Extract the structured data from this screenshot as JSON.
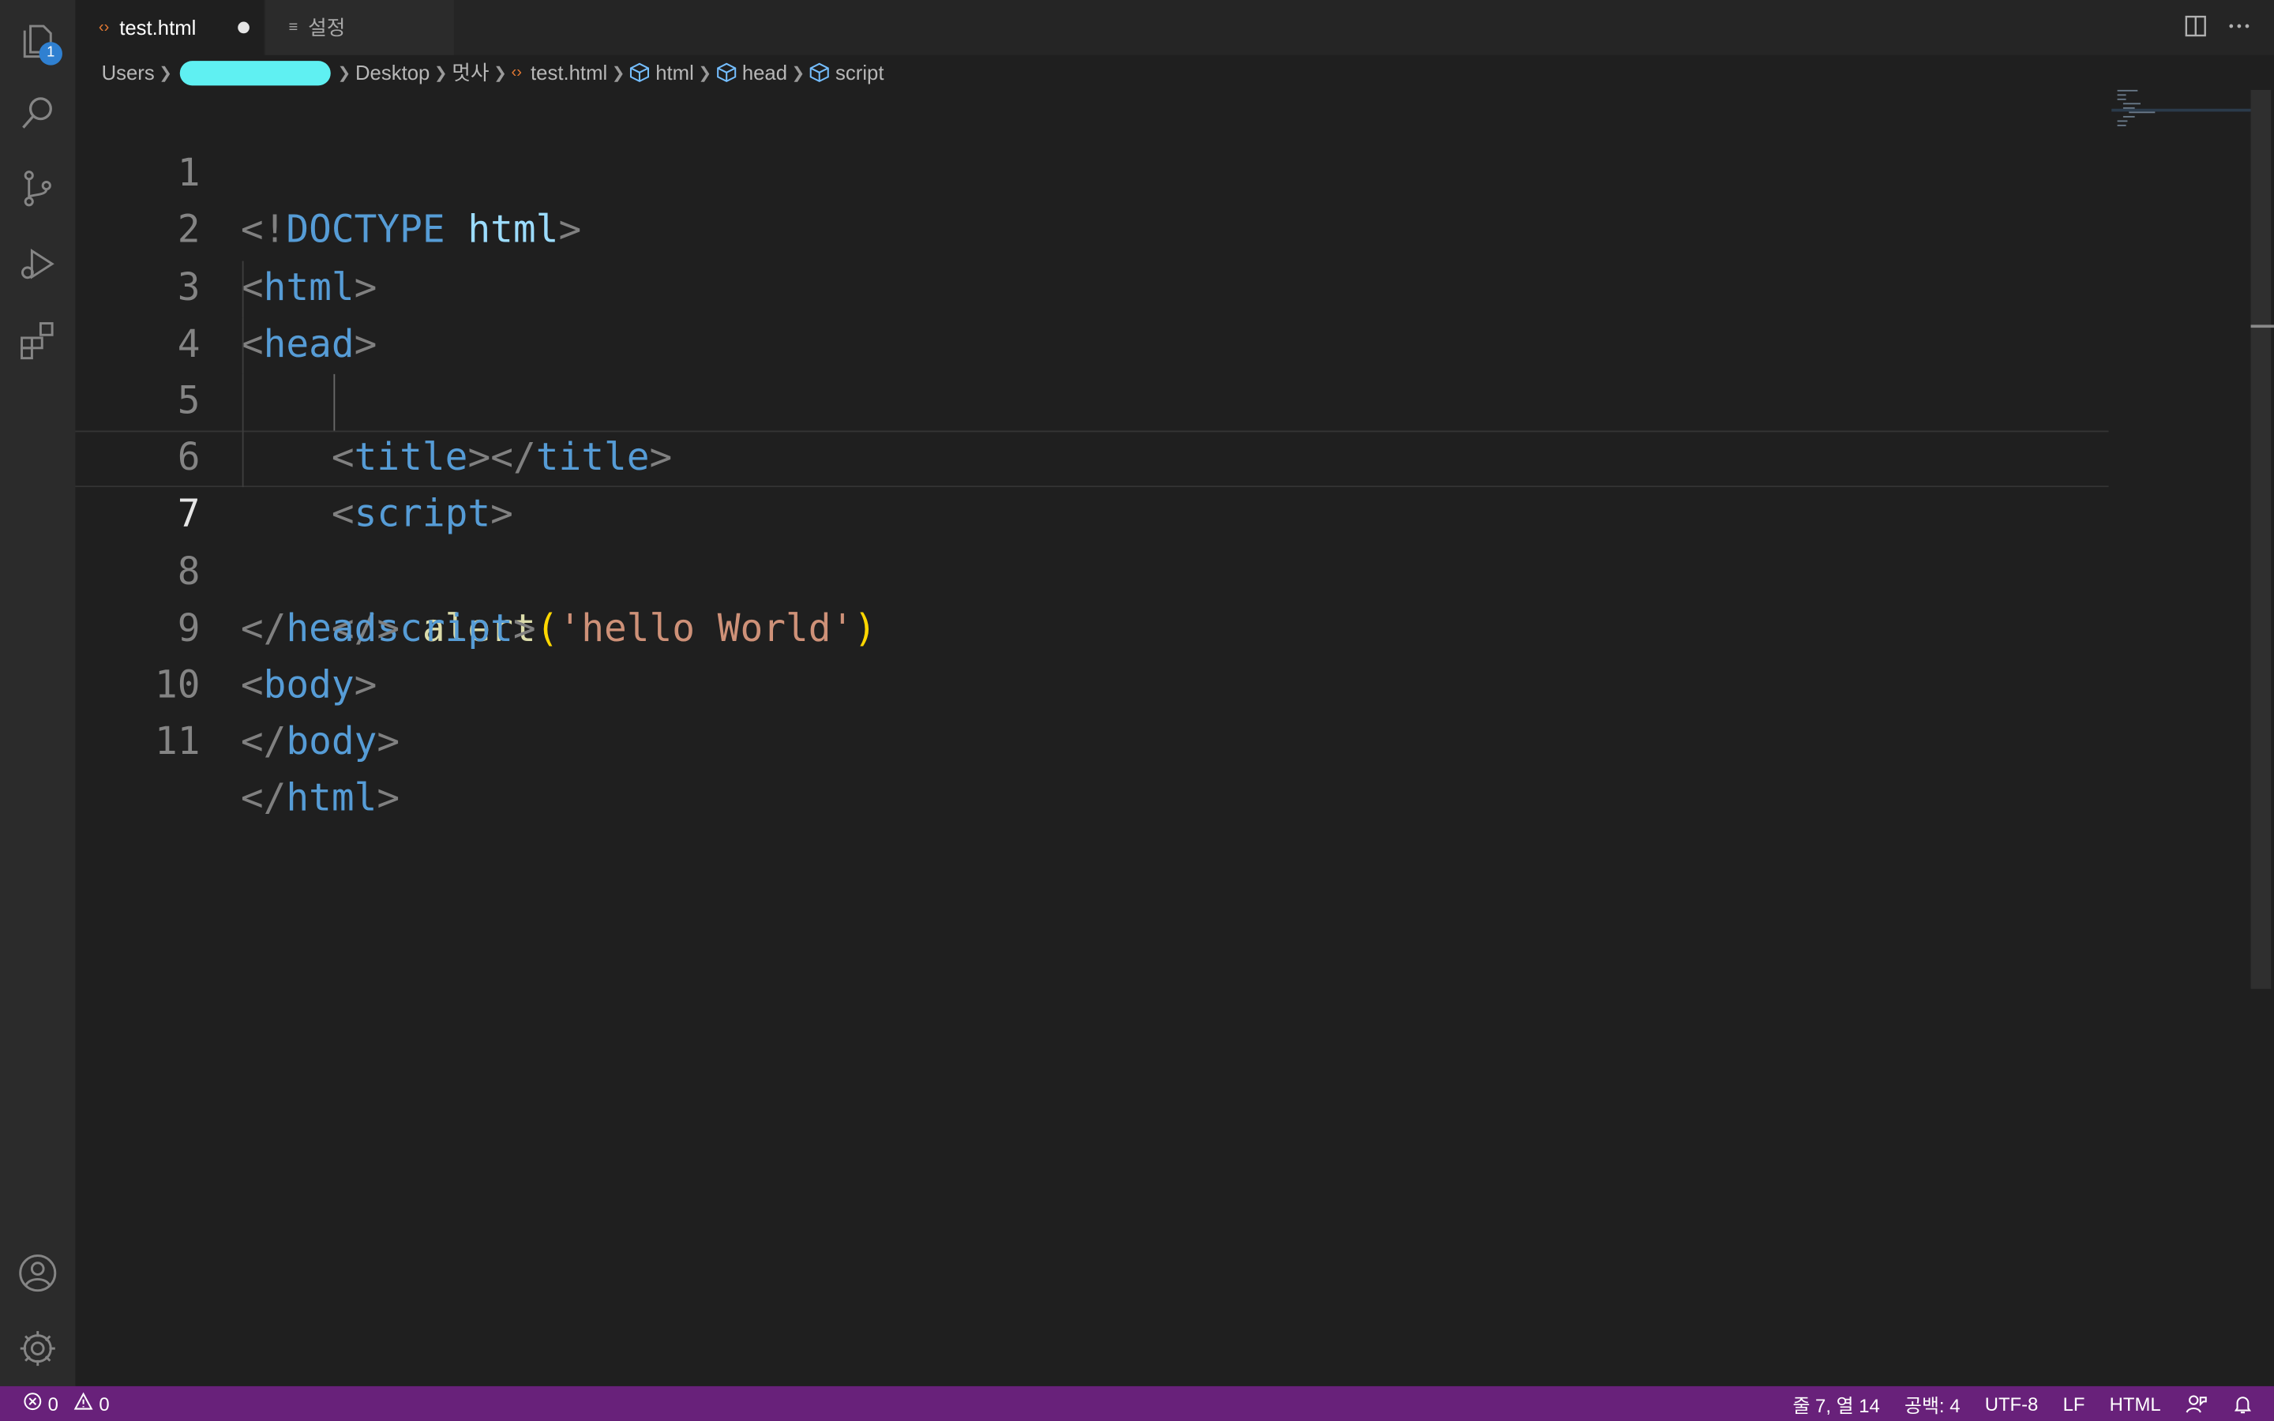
{
  "tabs": [
    {
      "icon": "‹›",
      "label": "test.html",
      "dirty": true
    },
    {
      "icon": "≡",
      "label": "설정"
    }
  ],
  "activity": {
    "explorer_badge": "1"
  },
  "breadcrumb": {
    "items": [
      "Users",
      "Desktop",
      "멋사",
      "test.html",
      "html",
      "head",
      "script"
    ]
  },
  "editor": {
    "lines": [
      {
        "n": "1"
      },
      {
        "n": "2"
      },
      {
        "n": "3"
      },
      {
        "n": "4"
      },
      {
        "n": "5"
      },
      {
        "n": "6"
      },
      {
        "n": "7"
      },
      {
        "n": "8"
      },
      {
        "n": "9"
      },
      {
        "n": "10"
      },
      {
        "n": "11"
      }
    ],
    "tokens": {
      "doctype_kw": "DOCTYPE",
      "doctype_attr": "html",
      "html": "html",
      "head": "head",
      "title": "title",
      "script": "script",
      "body": "body",
      "alert_fn": "alert",
      "alert_arg": "'hello World'"
    }
  },
  "status": {
    "errors": "0",
    "warnings": "0",
    "position": "줄 7, 열 14",
    "indent": "공백: 4",
    "encoding": "UTF-8",
    "eol": "LF",
    "language": "HTML"
  },
  "colors": {
    "status_bar": "#68217a",
    "tag": "#569cd6",
    "punctuation": "#808080",
    "string": "#ce9178",
    "function": "#dcdcaa",
    "attribute": "#9cdcfe"
  }
}
